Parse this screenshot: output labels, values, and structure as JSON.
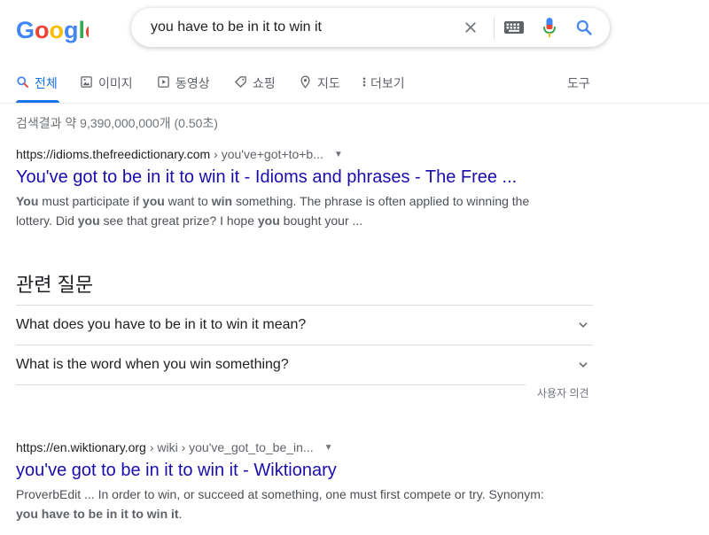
{
  "logo": {
    "letters": [
      "G",
      "o",
      "o",
      "g",
      "l",
      "e"
    ],
    "colors": [
      "#4285f4",
      "#ea4335",
      "#fbbc05",
      "#4285f4",
      "#34a853",
      "#ea4335"
    ]
  },
  "search": {
    "query": "you have to be in it to win it"
  },
  "icons": {
    "clear": "close-icon",
    "keyboard": "keyboard-icon",
    "voice": "mic-icon",
    "search": "search-icon"
  },
  "tabs": [
    {
      "label": "전체",
      "icon": "search-icon",
      "active": true
    },
    {
      "label": "이미지",
      "icon": "image-icon"
    },
    {
      "label": "동영상",
      "icon": "video-icon"
    },
    {
      "label": "쇼핑",
      "icon": "tag-icon"
    },
    {
      "label": "지도",
      "icon": "map-pin-icon"
    },
    {
      "label": "더보기",
      "icon": "more-vert-icon"
    }
  ],
  "tools_label": "도구",
  "result_stats": "검색결과 약 9,390,000,000개 (0.50초)",
  "results": [
    {
      "site": "https://idioms.thefreedictionary.com",
      "path": " › you've+got+to+b...",
      "title": "You've got to be in it to win it - Idioms and phrases - The Free ...",
      "snippet": [
        {
          "b": true,
          "t": "You"
        },
        {
          "t": " must participate if "
        },
        {
          "b": true,
          "t": "you"
        },
        {
          "t": " want to "
        },
        {
          "b": true,
          "t": "win"
        },
        {
          "t": " something. The phrase is often applied to winning the lottery. Did "
        },
        {
          "b": true,
          "t": "you"
        },
        {
          "t": " see that great prize? I hope "
        },
        {
          "b": true,
          "t": "you"
        },
        {
          "t": " bought your ..."
        }
      ]
    },
    {
      "site": "https://en.wiktionary.org",
      "path": " › wiki › you've_got_to_be_in...",
      "title": "you've got to be in it to win it - Wiktionary",
      "snippet": [
        {
          "t": "ProverbEdit ... In order to win, or succeed at something, one must first compete or try. Synonym: "
        },
        {
          "b": true,
          "t": "you have to be in it to win it"
        },
        {
          "t": "."
        }
      ]
    }
  ],
  "related_questions": {
    "heading": "관련 질문",
    "items": [
      "What does you have to be in it to win it mean?",
      "What is the word when you win something?"
    ],
    "feedback": "사용자 의견"
  }
}
